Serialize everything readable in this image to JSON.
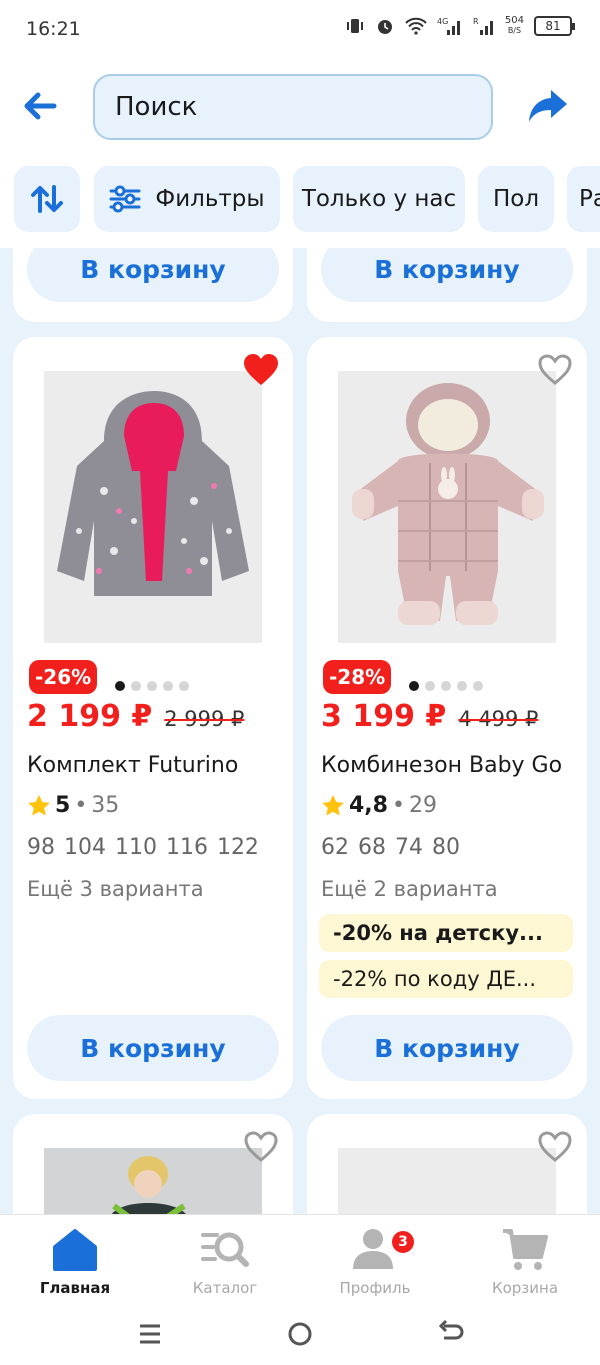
{
  "status_bar": {
    "time": "16:21",
    "net_speed_value": "504",
    "net_speed_unit": "B/S",
    "battery": "81"
  },
  "header": {
    "search_placeholder": "Поиск"
  },
  "chips": [
    {
      "label": ""
    },
    {
      "label": "Фильтры"
    },
    {
      "label": "Только у нас"
    },
    {
      "label": "Пол"
    },
    {
      "label": "Ра"
    }
  ],
  "cart_label": "В корзину",
  "products": [
    {
      "discount": "-26%",
      "price": "2 199 ₽",
      "old_price": "2 999 ₽",
      "title": "Комплект Futurino",
      "rating": "5",
      "reviews": "35",
      "sizes": "98  104  110  116  122",
      "variants": "Ещё 3 варианта",
      "favorite": true,
      "promos": []
    },
    {
      "discount": "-28%",
      "price": "3 199 ₽",
      "old_price": "4 499 ₽",
      "title": "Комбинезон Baby Go",
      "rating": "4,8",
      "reviews": "29",
      "sizes": "62  68  74  80",
      "variants": "Ещё 2 варианта",
      "favorite": false,
      "promos": [
        "-20% на детску...",
        "-22% по коду ДЕ..."
      ]
    }
  ],
  "bottom_nav": [
    {
      "label": "Главная",
      "icon": "home-icon",
      "active": true
    },
    {
      "label": "Каталог",
      "icon": "catalog-search-icon",
      "active": false
    },
    {
      "label": "Профиль",
      "icon": "profile-icon",
      "active": false,
      "badge": "3"
    },
    {
      "label": "Корзина",
      "icon": "cart-icon",
      "active": false
    }
  ],
  "colors": {
    "accent": "#1a6fd8",
    "sale": "#f2201d",
    "feed_bg": "#e8f2fb",
    "chip_bg": "#e8f2fc",
    "promo_bg": "#fdf8d3"
  }
}
